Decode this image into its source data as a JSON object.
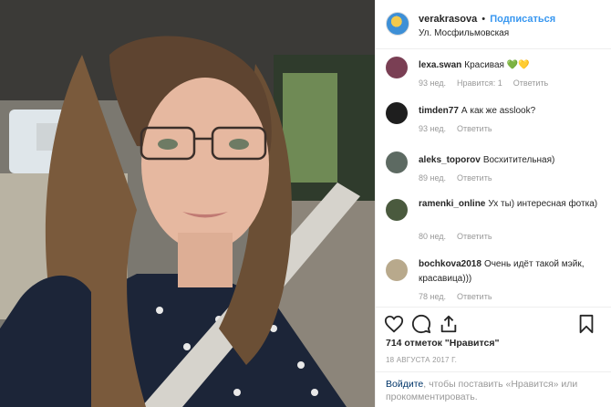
{
  "post": {
    "username": "verakrasova",
    "separator": "•",
    "follow_label": "Подписаться",
    "location": "Ул. Мосфильмовская"
  },
  "comments": [
    {
      "user": "lexa.swan",
      "text": "Красивая 💚💛",
      "age": "93 нед.",
      "likes": "Нравится: 1",
      "reply": "Ответить",
      "avatar_color": "#7a3f54"
    },
    {
      "user": "timden77",
      "text": "А как же asslook?",
      "age": "93 нед.",
      "likes": "",
      "reply": "Ответить",
      "avatar_color": "#1e1e1e"
    },
    {
      "user": "aleks_toporov",
      "text": "Восхитительная)",
      "age": "89 нед.",
      "likes": "",
      "reply": "Ответить",
      "avatar_color": "#5d6a62"
    },
    {
      "user": "ramenki_online",
      "text": "Ух ты) интересная фотка)",
      "age": "80 нед.",
      "likes": "",
      "reply": "Ответить",
      "avatar_color": "#4a5a3e"
    },
    {
      "user": "bochkova2018",
      "text": "Очень идёт такой мэйк, красавица)))",
      "age": "78 нед.",
      "likes": "",
      "reply": "Ответить",
      "avatar_color": "#b8a98c"
    }
  ],
  "actions": {
    "likes_text": "714 отметок \"Нравится\"",
    "date": "18 АВГУСТА 2017 Г.",
    "login_link": "Войдите",
    "login_rest": ", чтобы поставить «Нравится» или прокомментировать."
  },
  "colors": {
    "link_blue": "#3897f0",
    "text": "#262626",
    "muted": "#999999"
  }
}
